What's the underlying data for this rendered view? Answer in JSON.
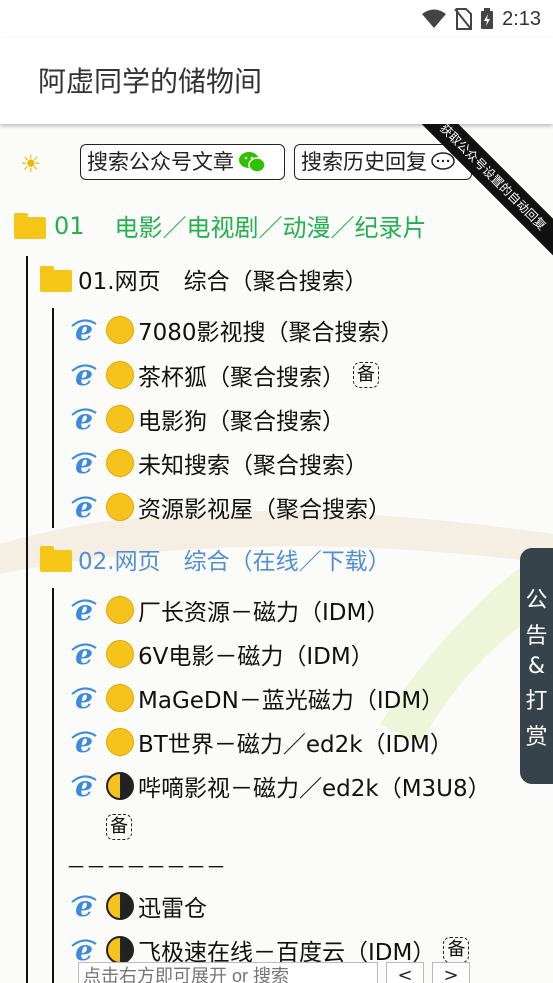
{
  "status": {
    "time": "2:13"
  },
  "appbar": {
    "title": "阿虚同学的储物间"
  },
  "toolbar": {
    "sun_icon": "sun-icon",
    "search_articles_label": "搜索公众号文章",
    "search_history_label": "搜索历史回复",
    "ribbon_text": "获取公众号设置的自动回复"
  },
  "category": {
    "number": "01",
    "title": "电影／电视剧／动漫／纪录片",
    "color": "#22b14c"
  },
  "sections": [
    {
      "title": "01.网页　综合（聚合搜索）",
      "color": "#111111",
      "items": [
        {
          "label": "7080影视搜（聚合搜索）",
          "dot": "full",
          "backup": ""
        },
        {
          "label": "茶杯狐（聚合搜索）",
          "dot": "full",
          "backup": "备"
        },
        {
          "label": "电影狗（聚合搜索）",
          "dot": "full",
          "backup": ""
        },
        {
          "label": "未知搜索（聚合搜索）",
          "dot": "full",
          "backup": ""
        },
        {
          "label": "资源影视屋（聚合搜索）",
          "dot": "full",
          "backup": ""
        }
      ]
    },
    {
      "title": "02.网页　综合（在线／下载）",
      "color": "#4f8fd6",
      "items": [
        {
          "label": "厂长资源－磁力（IDM）",
          "dot": "full",
          "backup": ""
        },
        {
          "label": "6V电影－磁力（IDM）",
          "dot": "full",
          "backup": ""
        },
        {
          "label": "MaGeDN－蓝光磁力（IDM）",
          "dot": "full",
          "backup": ""
        },
        {
          "label": "BT世界－磁力／ed2k（IDM）",
          "dot": "full",
          "backup": ""
        },
        {
          "label": "哔嘀影视－磁力／ed2k（M3U8）",
          "dot": "half",
          "backup": "备"
        }
      ],
      "divider": "－－－－－－－－",
      "more_items": [
        {
          "label": "迅雷仓",
          "dot": "half",
          "backup": ""
        },
        {
          "label": "飞极速在线－百度云（IDM）",
          "dot": "half",
          "backup": "备"
        }
      ]
    }
  ],
  "side_panel": {
    "chars": [
      "公",
      "告",
      "&",
      "打",
      "赏"
    ]
  },
  "bottom": {
    "placeholder": "点击右方即可展开 or 搜索",
    "prev": "<",
    "next": ">"
  }
}
